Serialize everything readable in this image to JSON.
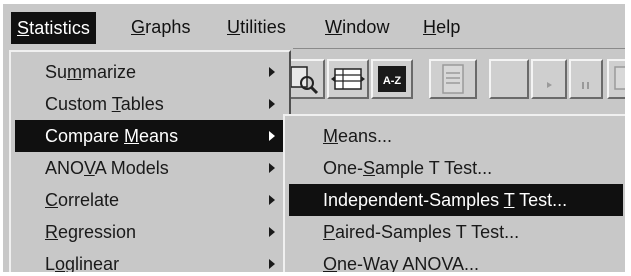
{
  "menubar": {
    "items": [
      {
        "pre": "",
        "mn": "S",
        "post": "tatistics"
      },
      {
        "pre": "",
        "mn": "G",
        "post": "raphs"
      },
      {
        "pre": "",
        "mn": "U",
        "post": "tilities"
      },
      {
        "pre": "",
        "mn": "W",
        "post": "indow"
      },
      {
        "pre": "",
        "mn": "H",
        "post": "elp"
      }
    ]
  },
  "statistics_menu": {
    "items": [
      {
        "pre": "Su",
        "mn": "m",
        "post": "marize"
      },
      {
        "pre": "Custom ",
        "mn": "T",
        "post": "ables"
      },
      {
        "pre": "Compare ",
        "mn": "M",
        "post": "eans"
      },
      {
        "pre": "ANO",
        "mn": "V",
        "post": "A Models"
      },
      {
        "pre": "",
        "mn": "C",
        "post": "orrelate"
      },
      {
        "pre": "",
        "mn": "R",
        "post": "egression"
      },
      {
        "pre": "L",
        "mn": "o",
        "post": "glinear"
      }
    ],
    "highlighted_index": 2
  },
  "compare_means_submenu": {
    "items": [
      {
        "pre": "",
        "mn": "M",
        "post": "eans..."
      },
      {
        "pre": "One-",
        "mn": "S",
        "post": "ample T Test..."
      },
      {
        "pre": "Independent-Samples ",
        "mn": "T",
        "post": " Test..."
      },
      {
        "pre": "",
        "mn": "P",
        "post": "aired-Samples T Test..."
      },
      {
        "pre": "",
        "mn": "O",
        "post": "ne-Way ANOVA..."
      }
    ],
    "highlighted_index": 2
  },
  "toolbar": {
    "buttons": [
      "find-icon",
      "value-labels-icon",
      "sort-az-icon",
      "document-icon",
      "blank-icon",
      "play-icon",
      "pause-icon",
      "insert-icon"
    ],
    "sort_button_text": "A-Z"
  },
  "colors": {
    "menu_bg": "#c8c8c8",
    "highlight_bg": "#101010",
    "highlight_text": "#ffffff"
  }
}
